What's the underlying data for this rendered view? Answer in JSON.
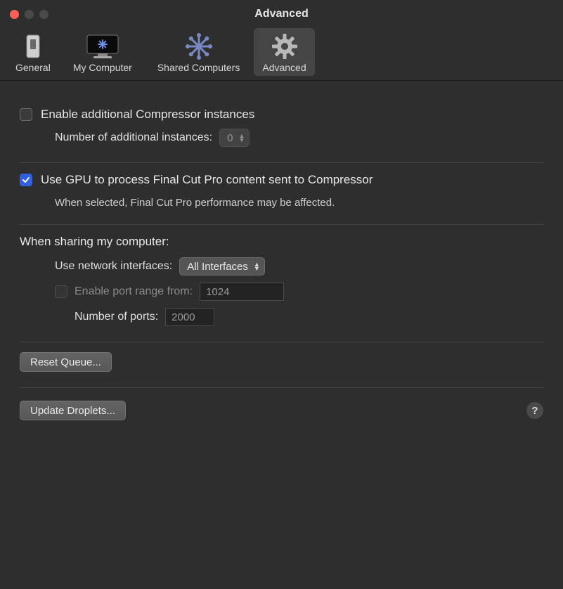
{
  "window": {
    "title": "Advanced"
  },
  "toolbar": {
    "items": [
      {
        "label": "General"
      },
      {
        "label": "My Computer"
      },
      {
        "label": "Shared Computers"
      },
      {
        "label": "Advanced"
      }
    ],
    "selected_index": 3
  },
  "section1": {
    "enable_instances_label": "Enable additional Compressor instances",
    "enable_instances_checked": false,
    "num_instances_label": "Number of additional instances:",
    "num_instances_value": "0"
  },
  "section2": {
    "use_gpu_label": "Use GPU to process Final Cut Pro content sent to Compressor",
    "use_gpu_checked": true,
    "use_gpu_note": "When selected, Final Cut Pro performance may be affected."
  },
  "section3": {
    "heading": "When sharing my computer:",
    "network_label": "Use network interfaces:",
    "network_value": "All Interfaces",
    "enable_port_label": "Enable port range from:",
    "enable_port_checked": false,
    "port_from_value": "1024",
    "num_ports_label": "Number of ports:",
    "num_ports_value": "2000"
  },
  "buttons": {
    "reset_queue": "Reset Queue...",
    "update_droplets": "Update Droplets..."
  },
  "icons": {
    "general": "general-icon",
    "my_computer": "monitor-icon",
    "shared": "snowflake-icon",
    "advanced": "gear-icon",
    "help": "?"
  }
}
